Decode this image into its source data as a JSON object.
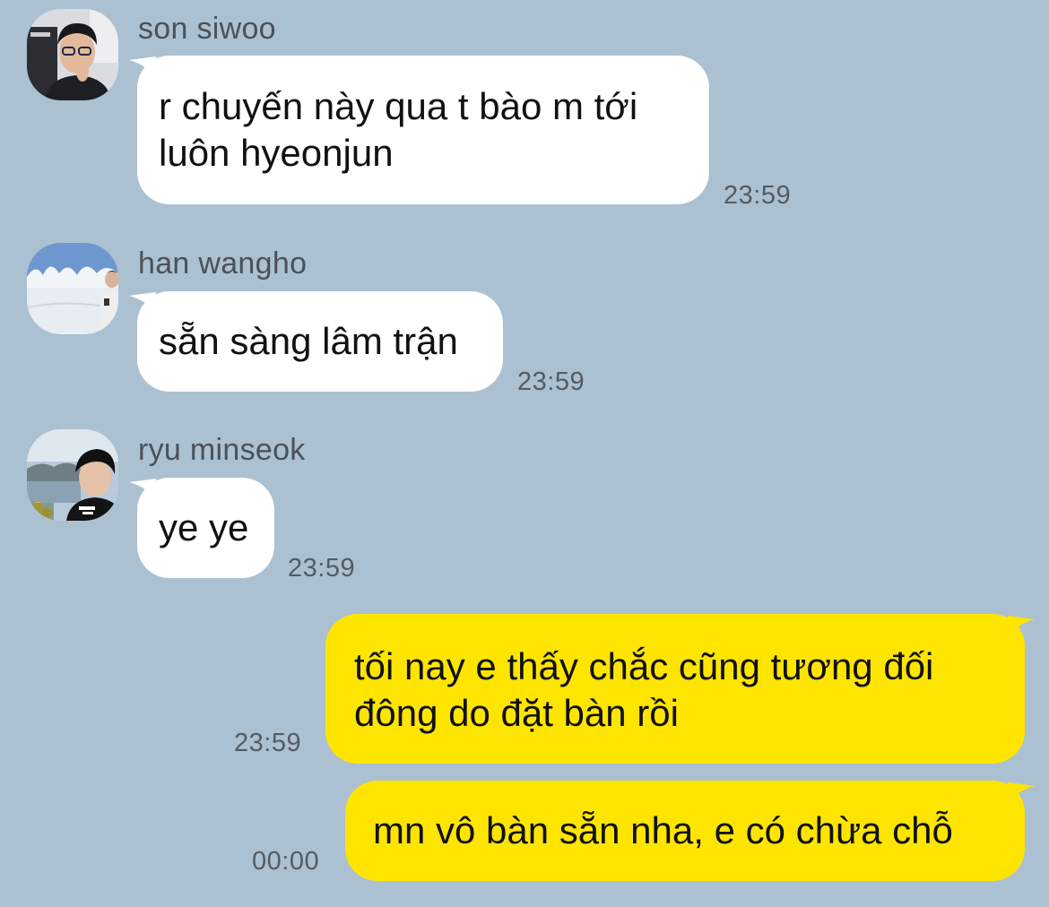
{
  "colors": {
    "background": "#abc1d1",
    "incoming_bubble": "#ffffff",
    "outgoing_bubble": "#fee500",
    "timestamp": "#545b63",
    "sender_name": "#4a5159"
  },
  "messages": [
    {
      "direction": "incoming",
      "sender": "son siwoo",
      "avatar": "avatar-son-siwoo",
      "lines": [
        "r chuyến này qua t bào m tới",
        "luôn hyeonjun"
      ],
      "time": "23:59"
    },
    {
      "direction": "incoming",
      "sender": "han wangho",
      "avatar": "avatar-han-wangho",
      "lines": [
        "sẵn sàng lâm trận"
      ],
      "time": "23:59"
    },
    {
      "direction": "incoming",
      "sender": "ryu minseok",
      "avatar": "avatar-ryu-minseok",
      "lines": [
        "ye ye"
      ],
      "time": "23:59"
    },
    {
      "direction": "outgoing",
      "lines": [
        "tối nay e thấy chắc cũng tương đối",
        "đông do đặt bàn rồi"
      ],
      "time": "23:59"
    },
    {
      "direction": "outgoing",
      "lines": [
        "mn vô bàn sẵn nha, e có chừa chỗ"
      ],
      "time": "00:00"
    }
  ]
}
